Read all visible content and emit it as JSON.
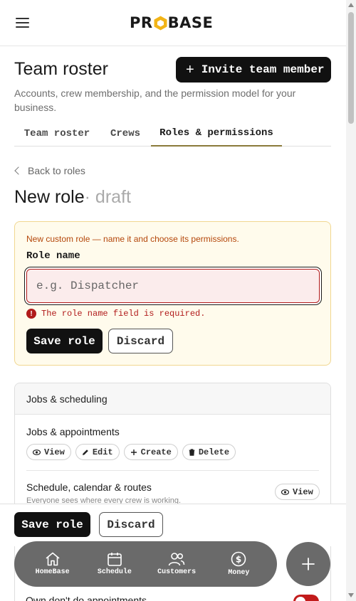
{
  "header": {
    "brand": "PROBASE"
  },
  "page": {
    "title": "Team roster",
    "subtitle": "Accounts, crew membership, and the permission model for your business.",
    "invite_label": "Invite team member"
  },
  "tabs": [
    {
      "label": "Team roster",
      "active": false
    },
    {
      "label": "Crews",
      "active": false
    },
    {
      "label": "Roles & permissions",
      "active": true
    }
  ],
  "role_editor": {
    "back_label": "Back to roles",
    "title": "New role",
    "status": "· draft",
    "notice": "New custom role — name it and choose its permissions.",
    "field_label": "Role name",
    "field_value": "",
    "field_placeholder": "e.g. Dispatcher",
    "error": "The role name field is required.",
    "save_label": "Save role",
    "discard_label": "Discard"
  },
  "permissions": {
    "group": "Jobs & scheduling",
    "rows": [
      {
        "title": "Jobs & appointments",
        "actions": [
          "View",
          "Edit",
          "Create",
          "Delete"
        ]
      },
      {
        "title": "Schedule, calendar & routes",
        "subtitle": "Everyone sees where every crew is working.",
        "actions": [
          "View"
        ]
      }
    ],
    "peek_row": "Own don't do appointments"
  },
  "sticky_bar": {
    "save_label": "Save role",
    "discard_label": "Discard"
  },
  "bottom_nav": [
    {
      "label": "HomeBase",
      "icon": "home-icon"
    },
    {
      "label": "Schedule",
      "icon": "calendar-icon"
    },
    {
      "label": "Customers",
      "icon": "users-icon"
    },
    {
      "label": "Money",
      "icon": "dollar-icon"
    }
  ],
  "colors": {
    "accent_dark": "#111111",
    "error": "#b11b1b",
    "warning_bg": "#fffbec",
    "tab_underline": "#8a7a3a",
    "nav_bg": "#6a6a6a",
    "logo_accent": "#f2b417"
  }
}
